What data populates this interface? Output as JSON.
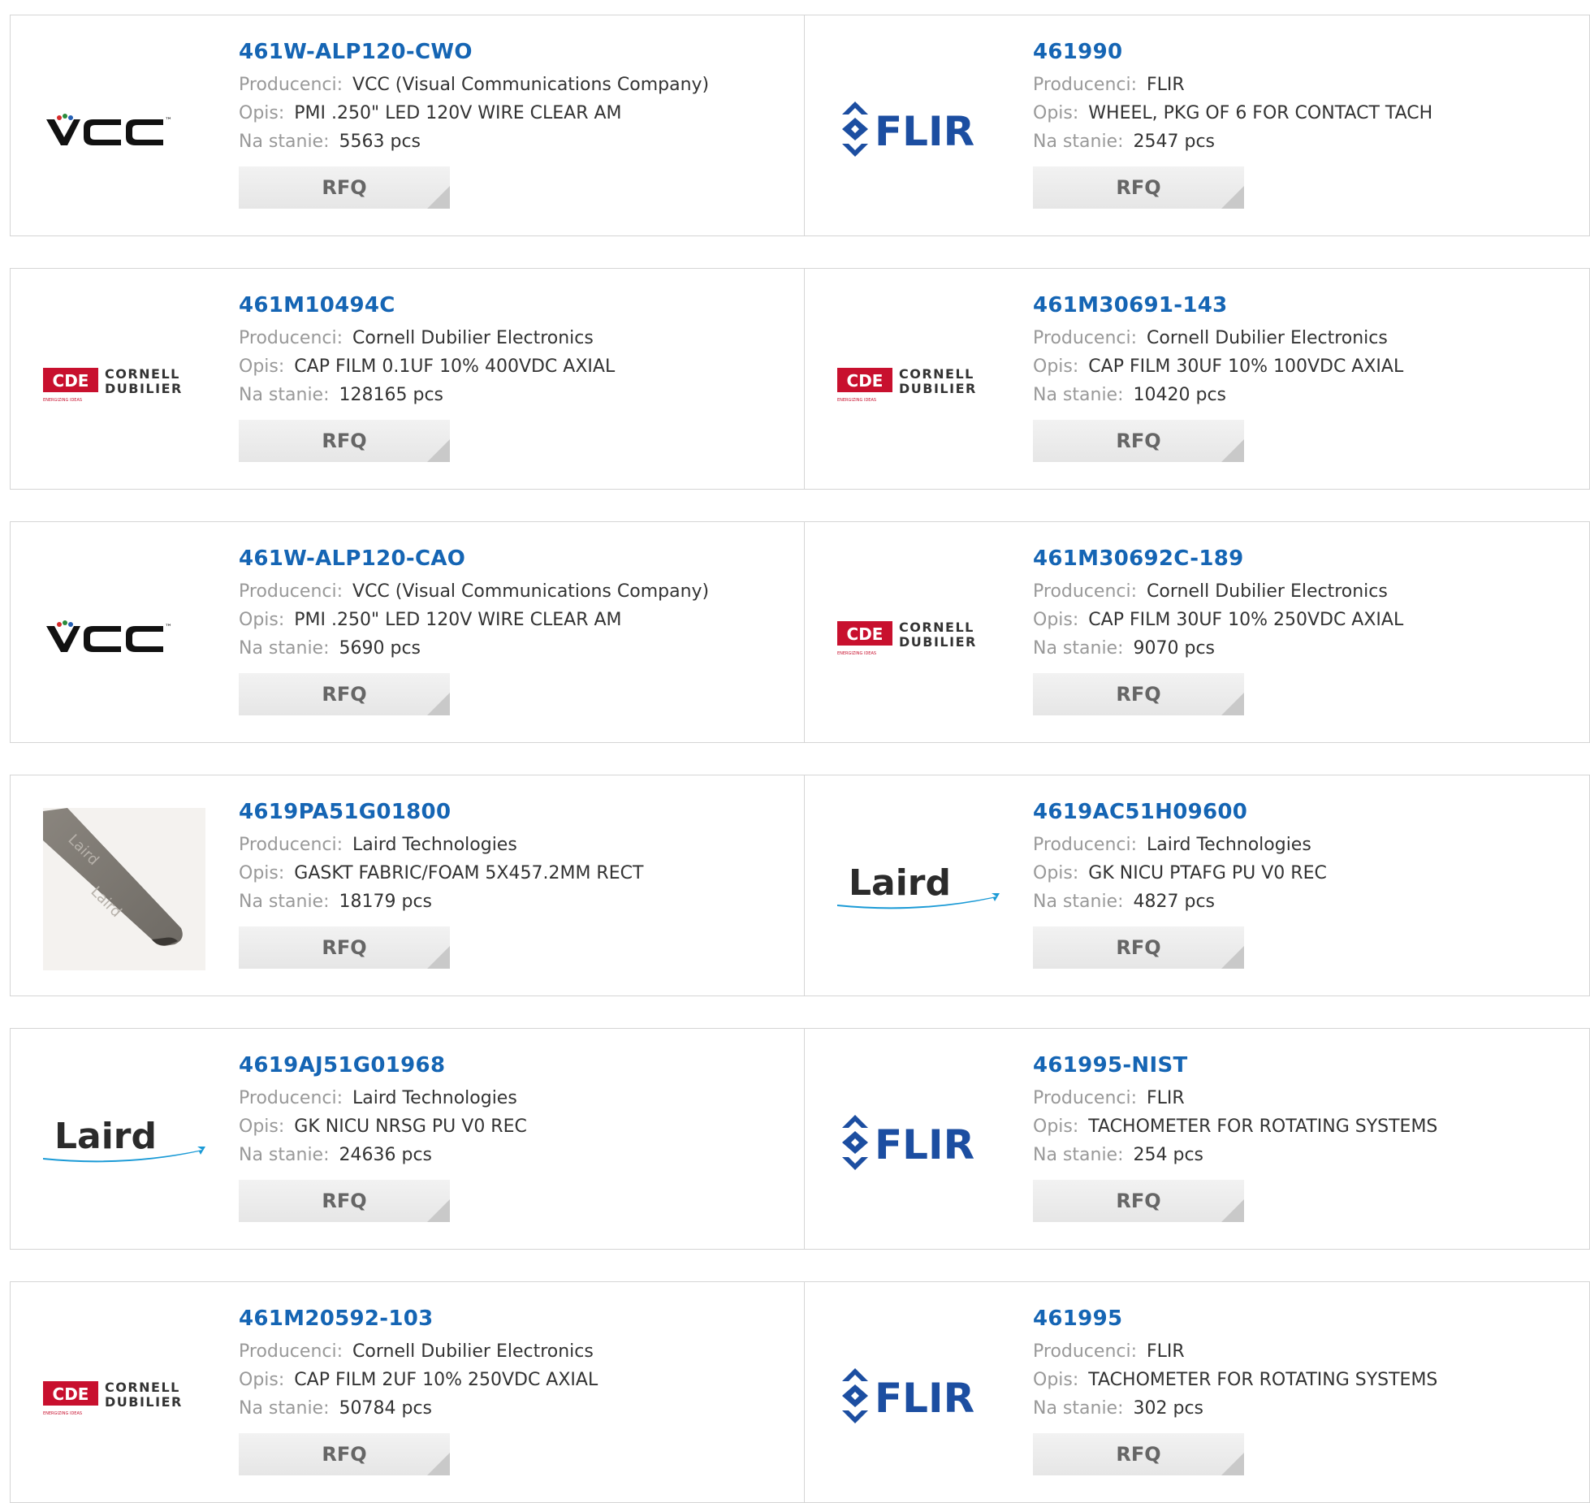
{
  "labels": {
    "manufacturer": "Producenci:",
    "description": "Opis:",
    "stock": "Na stanie:"
  },
  "rfq_label": "RFQ",
  "rows": [
    {
      "left": {
        "part": "461W-ALP120-CWO",
        "logo": "vcc-logo",
        "manufacturer": "VCC (Visual Communications Company)",
        "description": "PMI .250\" LED 120V WIRE CLEAR AM",
        "stock": "5563 pcs"
      },
      "right": {
        "part": "461990",
        "logo": "flir-logo",
        "manufacturer": "FLIR",
        "description": "WHEEL, PKG OF 6 FOR CONTACT TACH",
        "stock": "2547 pcs"
      }
    },
    {
      "left": {
        "part": "461M10494C",
        "logo": "cde-logo",
        "manufacturer": "Cornell Dubilier Electronics",
        "description": "CAP FILM 0.1UF 10% 400VDC AXIAL",
        "stock": "128165 pcs"
      },
      "right": {
        "part": "461M30691-143",
        "logo": "cde-logo",
        "manufacturer": "Cornell Dubilier Electronics",
        "description": "CAP FILM 30UF 10% 100VDC AXIAL",
        "stock": "10420 pcs"
      }
    },
    {
      "left": {
        "part": "461W-ALP120-CAO",
        "logo": "vcc-logo",
        "manufacturer": "VCC (Visual Communications Company)",
        "description": "PMI .250\" LED 120V WIRE CLEAR AM",
        "stock": "5690 pcs"
      },
      "right": {
        "part": "461M30692C-189",
        "logo": "cde-logo",
        "manufacturer": "Cornell Dubilier Electronics",
        "description": "CAP FILM 30UF 10% 250VDC AXIAL",
        "stock": "9070 pcs"
      }
    },
    {
      "left": {
        "part": "4619PA51G01800",
        "logo": "gasket-photo",
        "manufacturer": "Laird Technologies",
        "description": "GASKT FABRIC/FOAM 5X457.2MM RECT",
        "stock": "18179 pcs"
      },
      "right": {
        "part": "4619AC51H09600",
        "logo": "laird-logo",
        "manufacturer": "Laird Technologies",
        "description": "GK NICU PTAFG PU V0 REC",
        "stock": "4827 pcs"
      }
    },
    {
      "left": {
        "part": "4619AJ51G01968",
        "logo": "laird-logo",
        "manufacturer": "Laird Technologies",
        "description": "GK NICU NRSG PU V0 REC",
        "stock": "24636 pcs"
      },
      "right": {
        "part": "461995-NIST",
        "logo": "flir-logo",
        "manufacturer": "FLIR",
        "description": "TACHOMETER FOR ROTATING SYSTEMS",
        "stock": "254 pcs"
      }
    },
    {
      "left": {
        "part": "461M20592-103",
        "logo": "cde-logo",
        "manufacturer": "Cornell Dubilier Electronics",
        "description": "CAP FILM 2UF 10% 250VDC AXIAL",
        "stock": "50784 pcs"
      },
      "right": {
        "part": "461995",
        "logo": "flir-logo",
        "manufacturer": "FLIR",
        "description": "TACHOMETER FOR ROTATING SYSTEMS",
        "stock": "302 pcs"
      }
    }
  ],
  "logo_text": {
    "vcc": "VCC",
    "vcc_tm": "™",
    "flir": "FLIR",
    "cde": "CDE",
    "cornell": "CORNELL",
    "dubilier": "DUBILIER",
    "cde_tagline": "ENERGIZING IDEAS",
    "laird": "Laird",
    "gasket": "Laird"
  },
  "colors": {
    "part_link": "#1565b4",
    "flir_blue": "#1c4ea1",
    "cde_red": "#c8102e",
    "laird_blue": "#1a9ad6",
    "laird_text": "#2b2b2b"
  }
}
